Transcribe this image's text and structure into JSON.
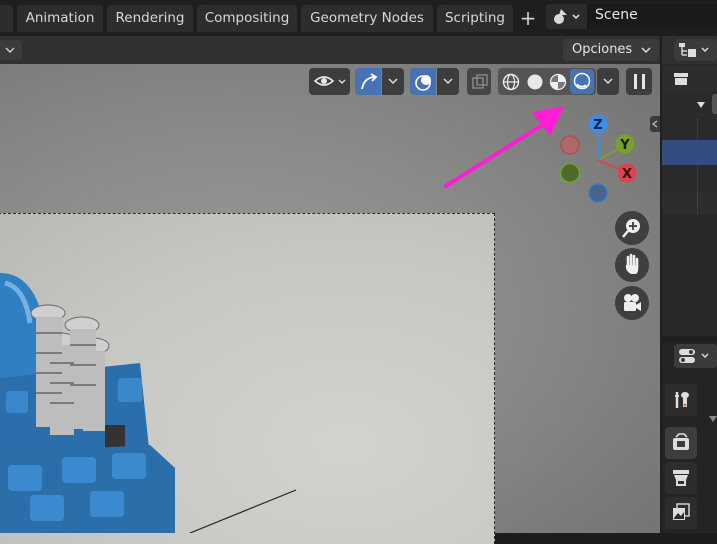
{
  "workspace_tabs": [
    {
      "label": "g"
    },
    {
      "label": "Animation"
    },
    {
      "label": "Rendering"
    },
    {
      "label": "Compositing"
    },
    {
      "label": "Geometry Nodes"
    },
    {
      "label": "Scripting"
    }
  ],
  "add_tab_symbol": "+",
  "scene": {
    "value": "Scene"
  },
  "viewport_header": {
    "options_label": "Opciones",
    "dropdown_symbol": "⌄"
  },
  "gizmo": {
    "z": "Z",
    "y": "Y",
    "x": "X"
  },
  "colors": {
    "accent": "#4772b3",
    "arrow": "#ff1dd6",
    "axis_x": "#e0414f",
    "axis_y": "#7aa12e",
    "axis_z": "#3b8fe8"
  },
  "icons": [
    "visibility-eye-icon",
    "gizmo-arrow-icon",
    "overlay-icon",
    "xray-icon",
    "wireframe-shading-icon",
    "solid-shading-icon",
    "material-preview-icon",
    "rendered-shading-icon",
    "pause-icon",
    "zoom-icon",
    "pan-hand-icon",
    "camera-view-icon",
    "outliner-editor-icon",
    "properties-editor-icon",
    "tool-icon",
    "render-icon",
    "output-icon",
    "view-layer-icon"
  ]
}
